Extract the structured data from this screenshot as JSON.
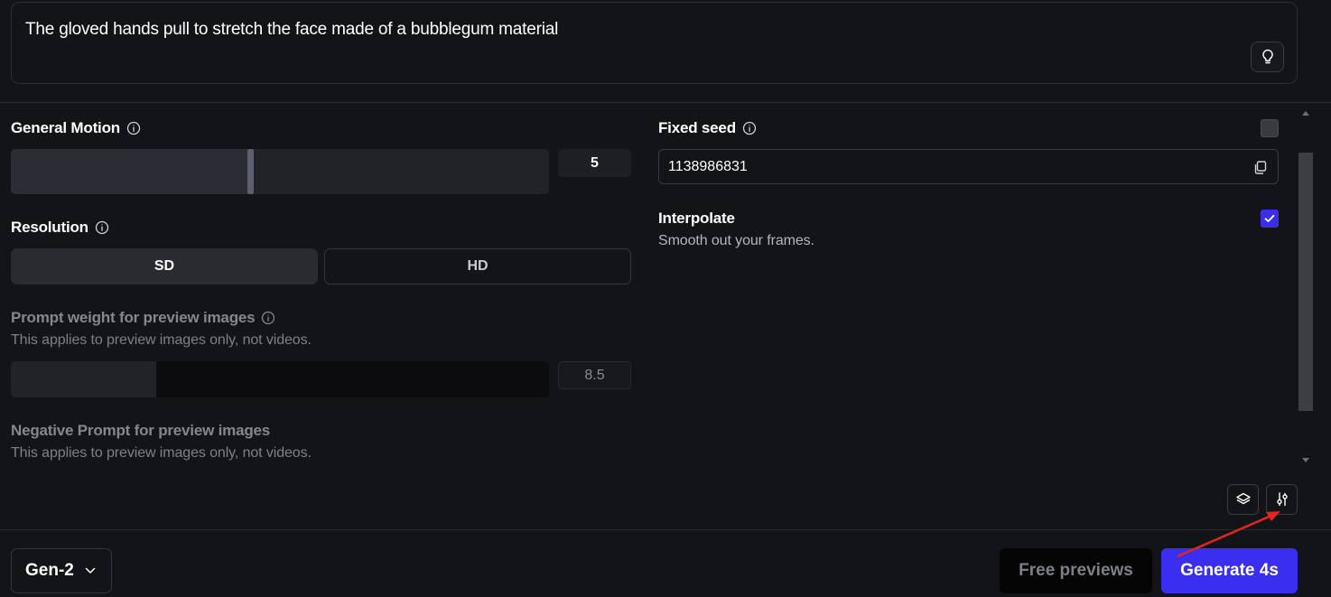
{
  "prompt": {
    "text": "The gloved hands pull to stretch the face made of a bubblegum material",
    "suggest_icon": "lightbulb-icon"
  },
  "settings": {
    "general_motion": {
      "label": "General Motion",
      "value": "5",
      "level": 0.44
    },
    "resolution": {
      "label": "Resolution",
      "options": [
        "SD",
        "HD"
      ],
      "selected": "SD"
    },
    "prompt_weight": {
      "label": "Prompt weight for preview images",
      "description": "This applies to preview images only, not videos.",
      "value": "8.5",
      "level": 0.27
    },
    "negative_prompt": {
      "label": "Negative Prompt for preview images",
      "description": "This applies to preview images only, not videos."
    },
    "fixed_seed": {
      "label": "Fixed seed",
      "checked": false,
      "value": "1138986831"
    },
    "interpolate": {
      "label": "Interpolate",
      "description": "Smooth out your frames.",
      "checked": true
    }
  },
  "toolbar": {
    "layers_icon": "layers-icon",
    "adjust_icon": "sliders-icon"
  },
  "footer": {
    "model": "Gen-2",
    "free_previews_label": "Free previews",
    "generate_label": "Generate 4s"
  },
  "colors": {
    "accent": "#3a2ff0",
    "background": "#131418",
    "annotation_arrow": "#e8221f"
  }
}
